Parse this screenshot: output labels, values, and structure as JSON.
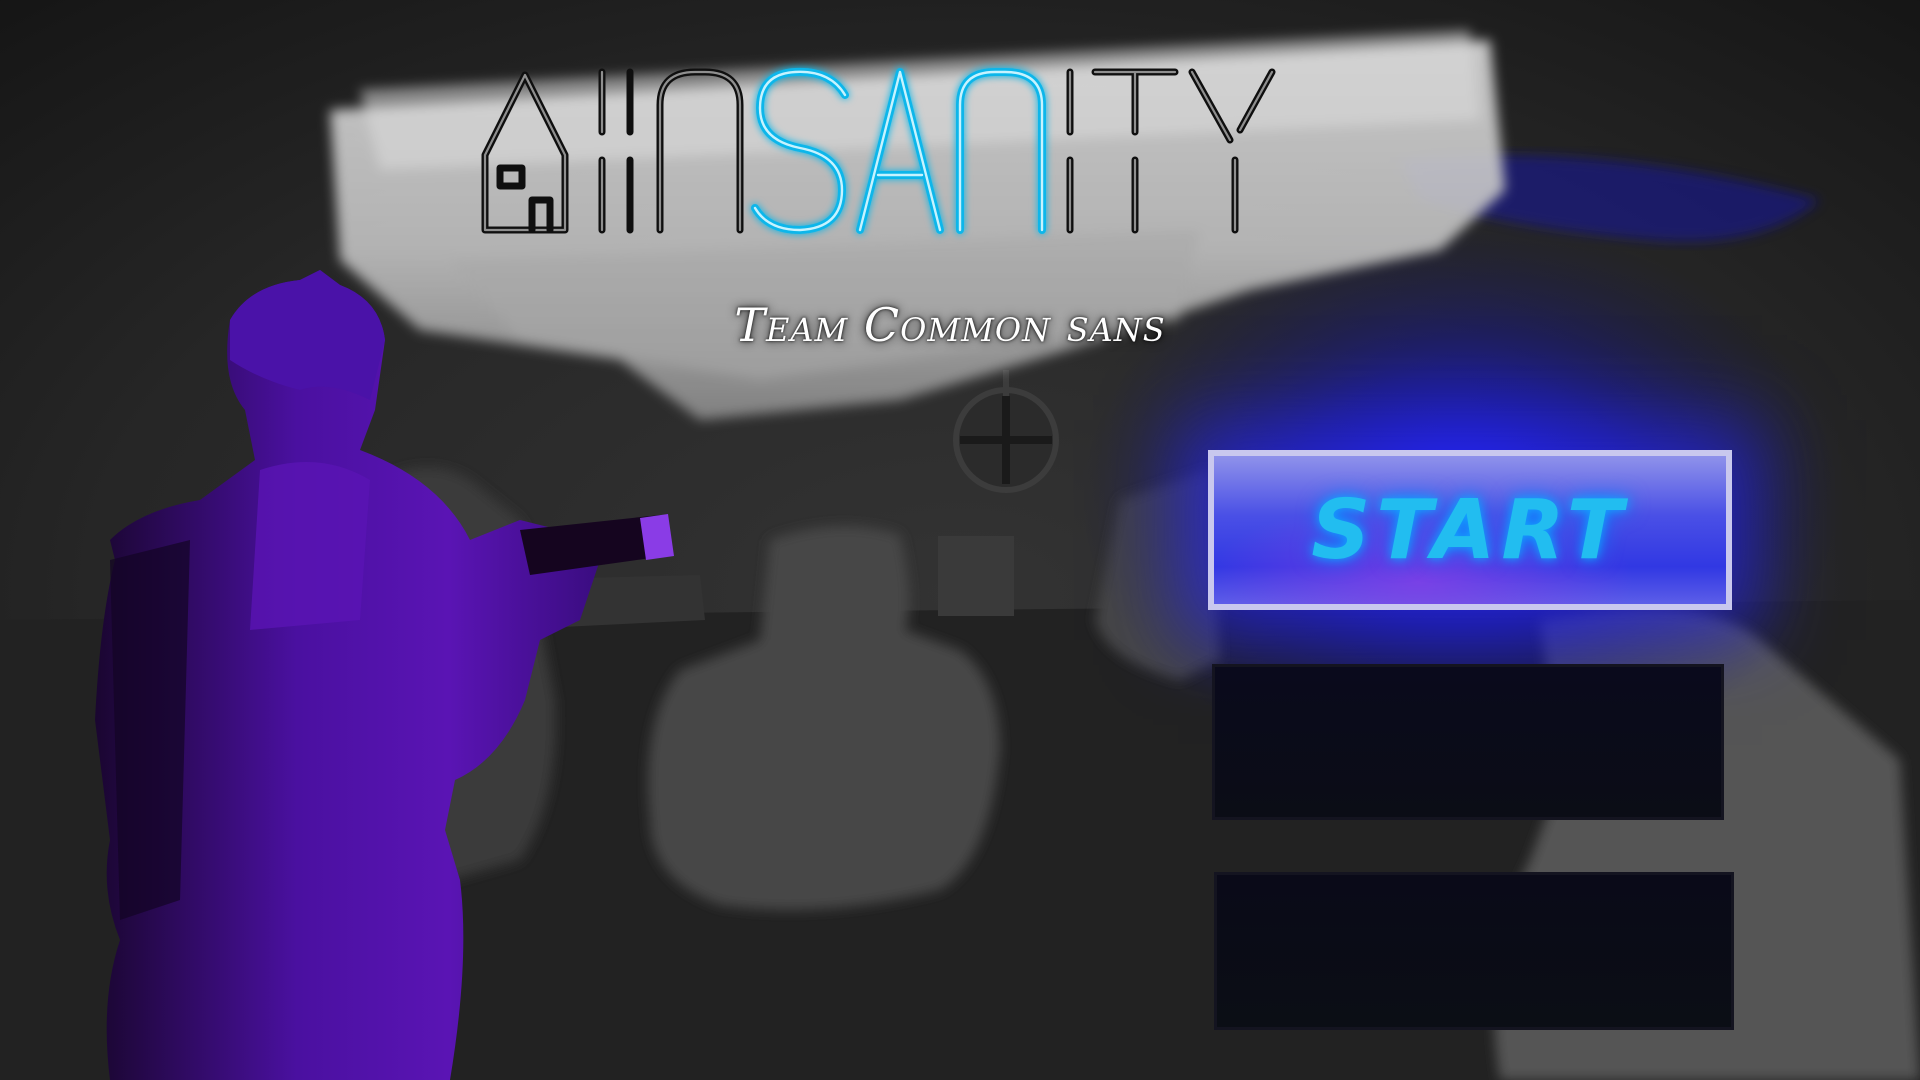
{
  "title": {
    "logo_text": "INSANITY",
    "neon_segment": "SAN",
    "subtitle": "Team Common sans"
  },
  "menu": {
    "start_label": "START",
    "button_2_label": "",
    "button_3_label": ""
  },
  "colors": {
    "background": "#1c1c1c",
    "neon_blue": "#11b6ea",
    "start_button_fill": "#3138e3",
    "character_purple": "#5a14b4",
    "blue_glow": "#2020ff"
  },
  "icons": {
    "logo_house": "house-icon",
    "ceiling_light": "crosshair-light-icon"
  }
}
